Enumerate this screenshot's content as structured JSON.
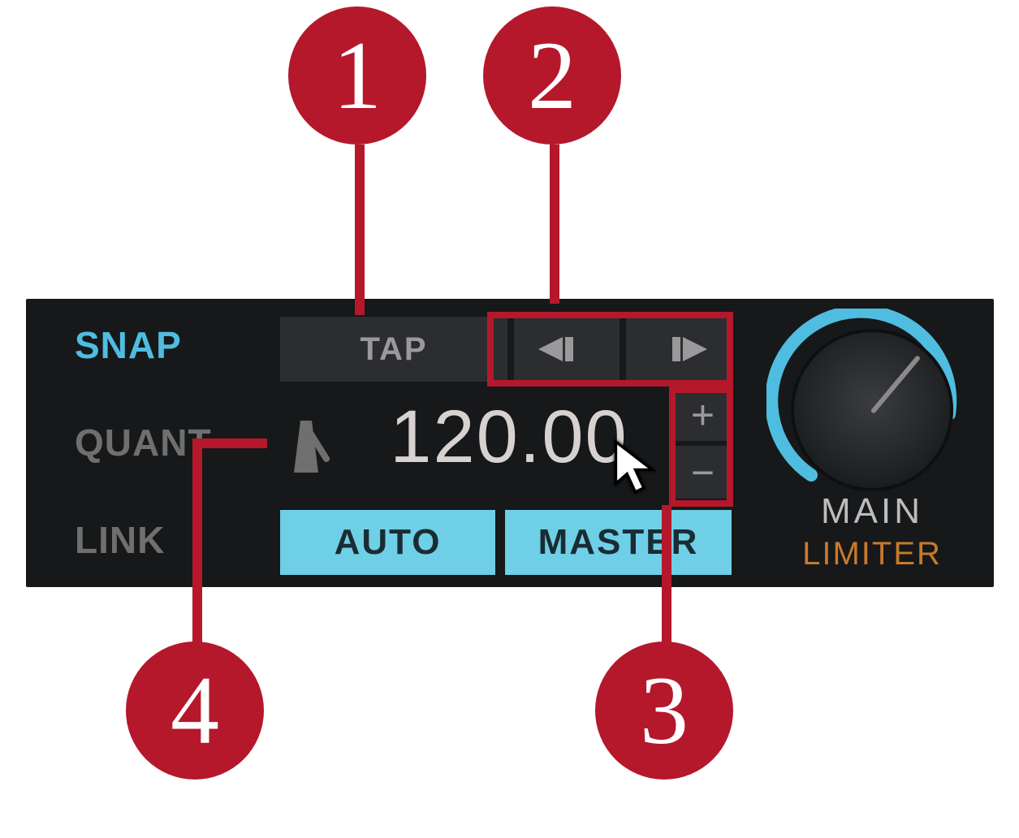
{
  "left": {
    "snap": "SNAP",
    "quant": "QUANT",
    "link": "LINK"
  },
  "tempo": {
    "tap_label": "TAP",
    "value": "120.00",
    "plus": "+",
    "minus": "−",
    "auto_label": "AUTO",
    "master_label": "MASTER",
    "metronome_icon": "metronome-icon",
    "bend_down_icon": "tempo-bend-down-icon",
    "bend_up_icon": "tempo-bend-up-icon"
  },
  "output": {
    "main_label": "MAIN",
    "limiter_label": "LIMITER"
  },
  "callouts": {
    "c1": "1",
    "c2": "2",
    "c3": "3",
    "c4": "4"
  },
  "colors": {
    "accent_cyan": "#4fbde0",
    "accent_orange": "#c77a2c",
    "callout_red": "#b5182b",
    "button_cyan": "#6fcfe6"
  }
}
